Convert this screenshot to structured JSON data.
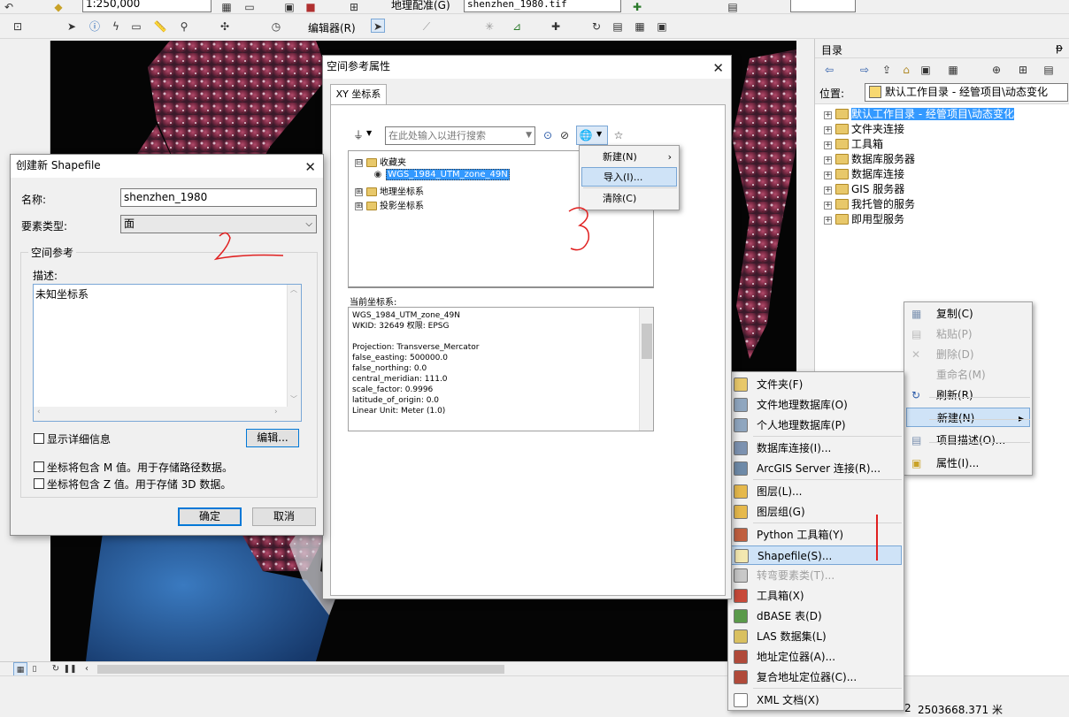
{
  "toolbar1": {
    "scale_value": "1:250,000",
    "georef_label": "地理配准(G)",
    "layer_value": "shenzhen_1980.tif"
  },
  "toolbar2": {
    "editor_label": "编辑器(R)"
  },
  "spatial_ref_dialog": {
    "title": "空间参考属性",
    "tab": "XY 坐标系",
    "search_placeholder": "在此处输入以进行搜索",
    "tree": [
      {
        "label": "收藏夹",
        "expanded": "⊟"
      },
      {
        "label": "WGS_1984_UTM_zone_49N",
        "selected": true
      },
      {
        "label": "地理坐标系",
        "expanded": "⊞"
      },
      {
        "label": "投影坐标系",
        "expanded": "⊞"
      }
    ],
    "current_label": "当前坐标系:",
    "current_lines": [
      "WGS_1984_UTM_zone_49N",
      "WKID: 32649 权限: EPSG",
      "",
      "Projection: Transverse_Mercator",
      "false_easting: 500000.0",
      "false_northing: 0.0",
      "central_meridian: 111.0",
      "scale_factor: 0.9996",
      "latitude_of_origin: 0.0",
      "Linear Unit: Meter (1.0)"
    ],
    "menu": {
      "new": "新建(N)",
      "import": "导入(I)...",
      "clear": "清除(C)"
    },
    "annotation": "3"
  },
  "shapefile_dialog": {
    "title": "创建新 Shapefile",
    "name_label": "名称:",
    "name_value": "shenzhen_1980",
    "type_label": "要素类型:",
    "type_value": "面",
    "group_label": "空间参考",
    "desc_label": "描述:",
    "desc_value": "未知坐标系",
    "show_details": "显示详细信息",
    "edit_btn": "编辑...",
    "m_check": "坐标将包含 M 值。用于存储路径数据。",
    "z_check": "坐标将包含 Z 值。用于存储 3D 数据。",
    "ok": "确定",
    "cancel": "取消",
    "annotation": "2"
  },
  "catalog": {
    "title": "目录",
    "location_label": "位置:",
    "location_value": "默认工作目录 - 经管项目\\动态变化",
    "tree": [
      "默认工作目录 - 经管项目\\动态变化",
      "文件夹连接",
      "工具箱",
      "数据库服务器",
      "数据库连接",
      "GIS 服务器",
      "我托管的服务",
      "即用型服务"
    ]
  },
  "context_menu": {
    "items": [
      {
        "label": "复制(C)",
        "enabled": true
      },
      {
        "label": "粘贴(P)",
        "enabled": false
      },
      {
        "label": "删除(D)",
        "enabled": false
      },
      {
        "label": "重命名(M)",
        "enabled": false
      },
      {
        "label": "刷新(R)",
        "enabled": true
      },
      {
        "label": "新建(N)",
        "enabled": true
      },
      {
        "label": "项目描述(O)...",
        "enabled": true
      },
      {
        "label": "属性(I)...",
        "enabled": true
      }
    ]
  },
  "new_submenu": {
    "items": [
      "文件夹(F)",
      "文件地理数据库(O)",
      "个人地理数据库(P)",
      "数据库连接(I)...",
      "ArcGIS Server 连接(R)...",
      "图层(L)...",
      "图层组(G)",
      "Python 工具箱(Y)",
      "Shapefile(S)...",
      "转弯要素类(T)...",
      "工具箱(X)",
      "dBASE 表(D)",
      "LAS 数据集(L)",
      "地址定位器(A)...",
      "复合地址定位器(C)...",
      "XML 文档(X)"
    ],
    "icon_colors": [
      "#e8c86a",
      "#8fa6bf",
      "#8fa6bf",
      "#7c92b0",
      "#6e8aa8",
      "#e6b94c",
      "#e6b94c",
      "#c06040",
      "#f3e8b0",
      "#c8c8c8",
      "#c84a3a",
      "#5a9a4a",
      "#d9c060",
      "#b04a3a",
      "#b04a3a",
      "#ffffff"
    ],
    "annotation": "1"
  },
  "status": {
    "coords": "2503668.371 米",
    "prefix": "2"
  }
}
